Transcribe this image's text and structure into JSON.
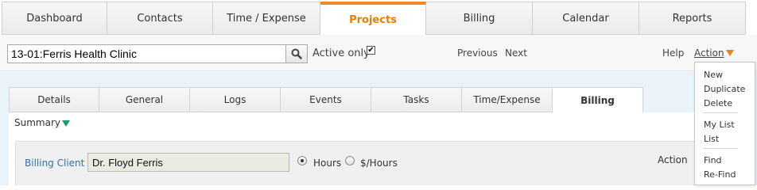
{
  "main_nav": {
    "tabs": [
      {
        "label": "Dashboard",
        "active": false
      },
      {
        "label": "Contacts",
        "active": false
      },
      {
        "label": "Time / Expense",
        "active": false
      },
      {
        "label": "Projects",
        "active": true
      },
      {
        "label": "Billing",
        "active": false
      },
      {
        "label": "Calendar",
        "active": false
      },
      {
        "label": "Reports",
        "active": false
      }
    ]
  },
  "toolbar": {
    "search_value": "13-01:Ferris Health Clinic",
    "search_icon": "search-icon",
    "active_only_label": "Active only",
    "active_only_checked": true,
    "previous_label": "Previous",
    "next_label": "Next",
    "help_label": "Help",
    "action_label": "Action"
  },
  "sub_nav": {
    "tabs": [
      {
        "label": "Details",
        "active": false
      },
      {
        "label": "General",
        "active": false
      },
      {
        "label": "Logs",
        "active": false
      },
      {
        "label": "Events",
        "active": false
      },
      {
        "label": "Tasks",
        "active": false
      },
      {
        "label": "Time/Expense",
        "active": false
      },
      {
        "label": "Billing",
        "active": true
      }
    ]
  },
  "summary_label": "Summary",
  "billing": {
    "client_label": "Billing Client",
    "client_value": "Dr. Floyd Ferris",
    "hours_label": "Hours",
    "dollars_label": "$/Hours",
    "selected_rate": "Hours",
    "action_label": "Action"
  },
  "action_menu": {
    "groups": [
      [
        "New",
        "Duplicate",
        "Delete"
      ],
      [
        "My List",
        "List"
      ],
      [
        "Find",
        "Re-Find"
      ]
    ]
  },
  "colors": {
    "active_tab_accent": "#f08a24",
    "action_arrow": "#e8811a",
    "summary_arrow": "#1a9b6b",
    "billing_label": "#2a6fc9",
    "content_background": "#eaf2fa"
  }
}
